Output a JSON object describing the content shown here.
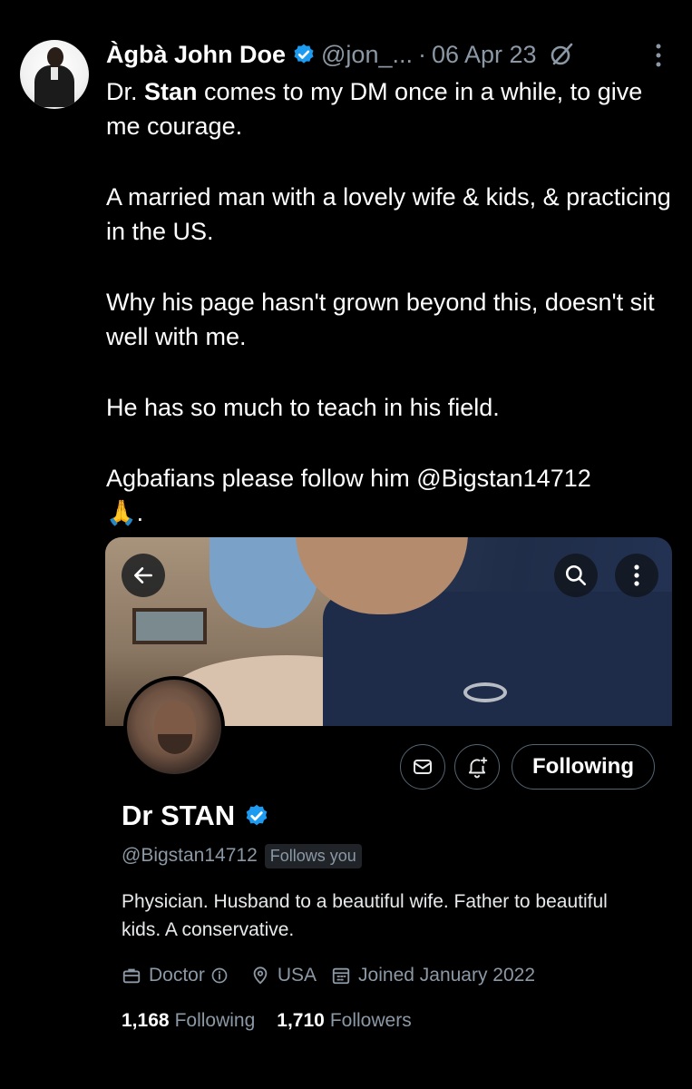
{
  "tweet": {
    "author_name": "Àgbà John Doe",
    "handle": "@jon_...",
    "separator": "·",
    "date": "06 Apr 23",
    "text": {
      "p1_mention": "Stan",
      "p1_prefix": "Dr. ",
      "p1_rest": " comes to my DM once in a while, to give me courage.",
      "p2": "A married man with a lovely wife & kids, & practicing in the US.",
      "p3": "Why his page hasn't grown beyond this, doesn't sit well with me.",
      "p4": "He has so much to teach in his field.",
      "p5": "Agbafians please follow him @Bigstan14712",
      "p5_end": "🙏."
    }
  },
  "embedded_profile": {
    "display_name": "Dr STAN",
    "handle": "@Bigstan14712",
    "follows_you": "Follows you",
    "following_button": "Following",
    "bio": "Physician. Husband to a beautiful wife. Father to beautiful kids. A conservative.",
    "profession": "Doctor",
    "location": "USA",
    "joined": "Joined January 2022",
    "following_count": "1,168",
    "following_label": "Following",
    "followers_count": "1,710",
    "followers_label": "Followers"
  },
  "icons": {
    "verified": "verified-badge-icon",
    "grok": "grok-icon",
    "more": "more-vertical-icon",
    "back": "back-arrow-icon",
    "search": "search-icon",
    "message": "message-icon",
    "notify": "notify-bell-icon",
    "profession": "briefcase-icon",
    "location": "location-pin-icon",
    "calendar": "calendar-icon"
  },
  "colors": {
    "background": "#000000",
    "text": "#e7e9ea",
    "muted": "#8b98a5",
    "verified": "#1d9bf0"
  }
}
